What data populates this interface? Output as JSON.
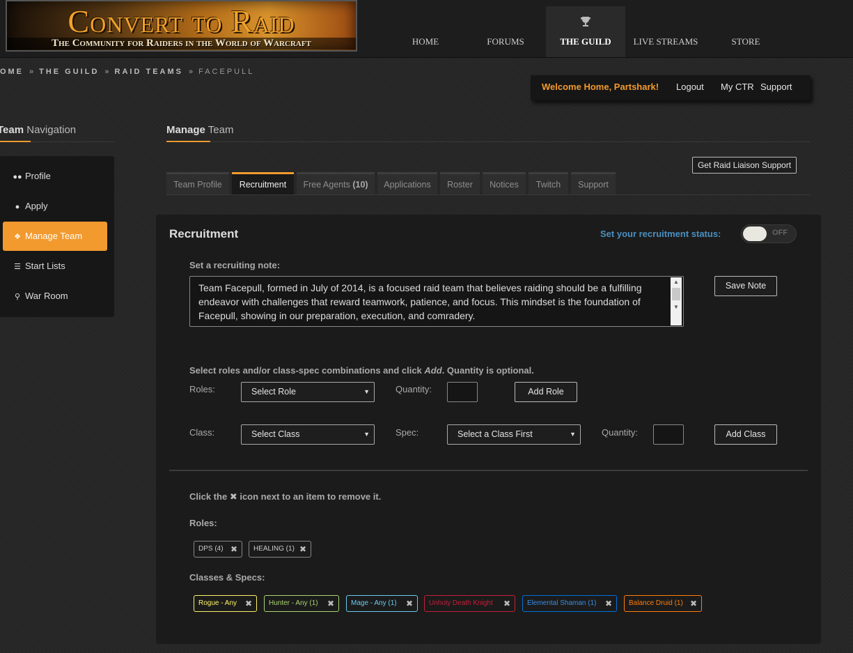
{
  "header": {
    "logo_title": "Convert to Raid",
    "logo_subtitle": "The Community for Raiders in the World of Warcraft",
    "nav": [
      "HOME",
      "FORUMS",
      "THE GUILD",
      "LIVE STREAMS",
      "STORE"
    ]
  },
  "breadcrumb": [
    "HOME",
    "THE GUILD",
    "RAID TEAMS",
    "FACEPULL"
  ],
  "welcome": {
    "text": "Welcome Home, Partshark!",
    "logout": "Logout",
    "my_ctr": "My CTR",
    "support": "Support"
  },
  "sidebar": {
    "heading_bold": "Team",
    "heading_rest": "Navigation",
    "items": [
      {
        "label": "Profile",
        "icon": "users-icon"
      },
      {
        "label": "Apply",
        "icon": "user-icon"
      },
      {
        "label": "Manage Team",
        "icon": "puzzle-icon"
      },
      {
        "label": "Start Lists",
        "icon": "list-icon"
      },
      {
        "label": "War Room",
        "icon": "trophy-icon"
      }
    ]
  },
  "main": {
    "heading_bold": "Manage",
    "heading_rest": "Team",
    "liaison_button": "Get Raid Liaison Support",
    "tabs": [
      "Team Profile",
      "Recruitment",
      "Free Agents",
      "Applications",
      "Roster",
      "Notices",
      "Twitch",
      "Support"
    ],
    "free_agents_count": "(10)",
    "active_tab": "Recruitment"
  },
  "recruitment": {
    "title": "Recruitment",
    "status_label": "Set your recruitment status:",
    "status_value": "OFF",
    "note_label": "Set a recruiting note:",
    "note_text": "Team Facepull, formed in July of 2014, is a focused raid team that believes raiding should be a fulfilling endeavor with challenges that reward teamwork, patience, and focus.  This mindset is the foundation of Facepull, showing in our preparation, execution, and comradery.",
    "save_note": "Save Note",
    "instructions_pre": "Select roles and/or class-spec combinations and click ",
    "instructions_em": "Add",
    "instructions_post": ". Quantity is optional.",
    "roles_label": "Roles:",
    "role_select": "Select Role",
    "quantity_label": "Quantity:",
    "add_role": "Add Role",
    "class_label": "Class:",
    "class_select": "Select Class",
    "spec_label": "Spec:",
    "spec_select": "Select a Class First",
    "add_class": "Add Class",
    "remove_pre": "Click the",
    "remove_post": "icon next to an item to remove it.",
    "roles_list_label": "Roles:",
    "roles": [
      "DPS (4)",
      "HEALING (1)"
    ],
    "classes_list_label": "Classes & Specs:",
    "classes": [
      {
        "label": "Rogue - Any",
        "color": "#fff468"
      },
      {
        "label": "Hunter - Any (1)",
        "color": "#abd473"
      },
      {
        "label": "Mage - Any (1)",
        "color": "#69ccf0"
      },
      {
        "label": "Unholy Death Knight",
        "color": "#c41f3b"
      },
      {
        "label": "Elemental Shaman (1)",
        "color": "#0070de"
      },
      {
        "label": "Balance Druid (1)",
        "color": "#ff7d0a"
      }
    ]
  },
  "colors": {
    "accent": "#f29a2e",
    "link_blue": "#4a90c2"
  }
}
